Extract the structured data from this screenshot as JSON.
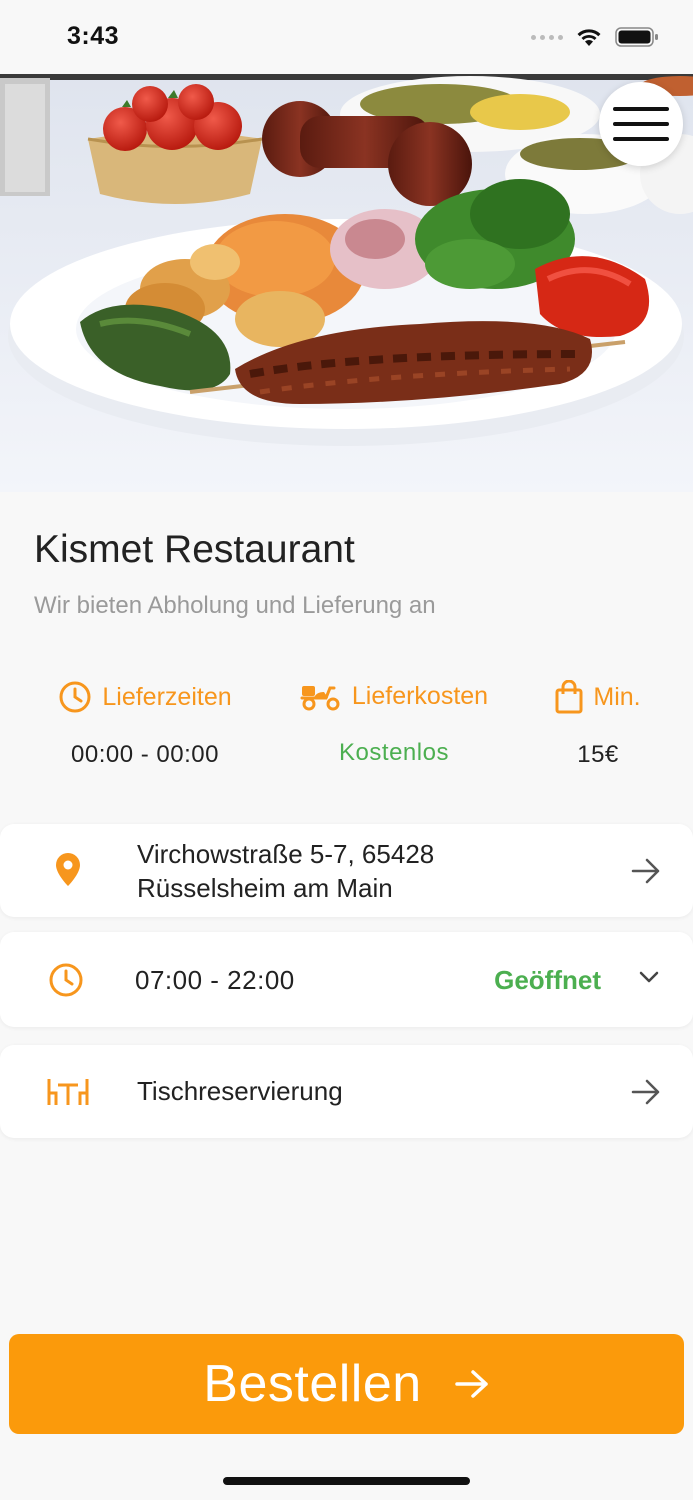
{
  "status_bar": {
    "time": "3:43"
  },
  "restaurant": {
    "name": "Kismet Restaurant",
    "tagline": "Wir bieten Abholung und Lieferung an"
  },
  "info": [
    {
      "label": "Lieferzeiten",
      "value": "00:00 - 00:00",
      "icon": "clock-icon"
    },
    {
      "label": "Lieferkosten",
      "value": "Kostenlos",
      "icon": "scooter-icon"
    },
    {
      "label": "Min.",
      "value": "15€",
      "icon": "shopping-bag-icon"
    }
  ],
  "address": {
    "line1": "Virchowstraße 5-7, 65428",
    "line2": "Rüsselsheim am Main"
  },
  "hours": {
    "range": "07:00 - 22:00",
    "status": "Geöffnet"
  },
  "reservation": {
    "label": "Tischreservierung"
  },
  "cta": {
    "label": "Bestellen"
  },
  "colors": {
    "accent": "#f7961d",
    "button": "#fb9a0b",
    "open": "#4caf50",
    "text": "#222222",
    "muted": "#9a9a9a"
  }
}
